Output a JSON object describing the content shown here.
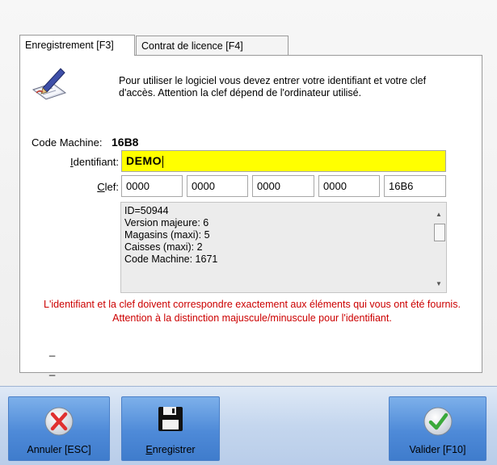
{
  "tabs": [
    {
      "label": "Enregistrement [F3]",
      "active": true
    },
    {
      "label": "Contrat de licence [F4]",
      "active": false
    }
  ],
  "intro_text": "Pour utiliser le logiciel vous devez entrer votre identifiant et votre clef d'accès. Attention la clef dépend de l'ordinateur utilisé.",
  "machine": {
    "label": "Code Machine:",
    "value": "16B8"
  },
  "identifiant": {
    "label_accel": "I",
    "label_rest": "dentifiant:",
    "value": "DEMO"
  },
  "clef": {
    "label_accel": "C",
    "label_rest": "lef:",
    "values": [
      "0000",
      "0000",
      "0000",
      "0000",
      "16B6"
    ]
  },
  "info_lines": [
    "ID=50944",
    "Version majeure: 6",
    "Magasins (maxi): 5",
    "Caisses (maxi): 2",
    "Code Machine: 1671"
  ],
  "warning": "L'identifiant et la clef doivent correspondre exactement aux éléments qui vous ont été fournis. Attention à la distinction majuscule/minuscule pour l'identifiant.",
  "dashes": [
    "_",
    "_"
  ],
  "buttons": {
    "cancel": "Annuler [ESC]",
    "save_accel": "E",
    "save_rest": "nregistrer",
    "ok": "Valider [F10]"
  },
  "colors": {
    "identifiant_bg": "#ffff00",
    "warning_text": "#cc0000",
    "button_blue": "#4e8ad8",
    "cancel_red": "#e03030",
    "ok_green": "#3aa93a"
  },
  "icons": [
    "pen-paper-icon",
    "cancel-x-icon",
    "floppy-disk-icon",
    "checkmark-icon",
    "scroll-up-icon",
    "scroll-down-icon"
  ]
}
